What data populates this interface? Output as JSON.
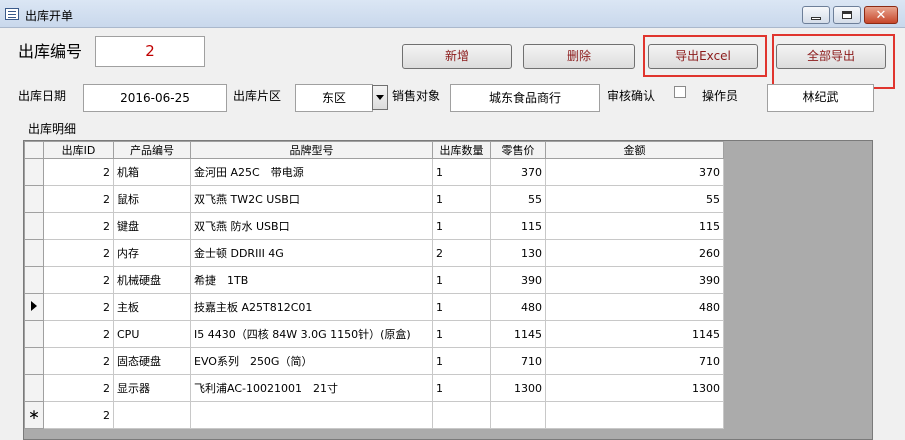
{
  "window": {
    "title": "出库开单"
  },
  "form": {
    "order_no_label": "出库编号",
    "order_no_value": "2",
    "date_label": "出库日期",
    "date_value": "2016-06-25",
    "area_label": "出库片区",
    "area_value": "东区",
    "customer_label": "销售对象",
    "customer_value": "城东食品商行",
    "approve_label": "审核确认",
    "operator_label": "操作员",
    "operator_value": "林纪武",
    "detail_label": "出库明细"
  },
  "buttons": {
    "add": "新增",
    "delete": "删除",
    "export_excel": "导出Excel",
    "export_all": "全部导出"
  },
  "table": {
    "columns": [
      "出库ID",
      "产品编号",
      "品牌型号",
      "出库数量",
      "零售价",
      "金额"
    ],
    "rows": [
      {
        "id": "2",
        "product": "机箱",
        "model": "金河田 A25C　带电源",
        "qty": "1",
        "price": "370",
        "amount": "370"
      },
      {
        "id": "2",
        "product": "鼠标",
        "model": "双飞燕 TW2C USB口",
        "qty": "1",
        "price": "55",
        "amount": "55"
      },
      {
        "id": "2",
        "product": "键盘",
        "model": "双飞燕 防水 USB口",
        "qty": "1",
        "price": "115",
        "amount": "115"
      },
      {
        "id": "2",
        "product": "内存",
        "model": "金士顿 DDRIII 4G",
        "qty": "2",
        "price": "130",
        "amount": "260"
      },
      {
        "id": "2",
        "product": "机械硬盘",
        "model": "希捷　1TB",
        "qty": "1",
        "price": "390",
        "amount": "390"
      },
      {
        "id": "2",
        "product": "主板",
        "model": "技嘉主板 A25T812C01",
        "qty": "1",
        "price": "480",
        "amount": "480"
      },
      {
        "id": "2",
        "product": "CPU",
        "model": "I5 4430（四核 84W 3.0G 1150针）(原盒)",
        "qty": "1",
        "price": "1145",
        "amount": "1145"
      },
      {
        "id": "2",
        "product": "固态硬盘",
        "model": "EVO系列　250G（简）",
        "qty": "1",
        "price": "710",
        "amount": "710"
      },
      {
        "id": "2",
        "product": "显示器",
        "model": "飞利浦AC-10021001　21寸",
        "qty": "1",
        "price": "1300",
        "amount": "1300"
      }
    ],
    "new_row_id": "2",
    "new_row_marker": "∗",
    "current_row_index": 5
  },
  "colors": {
    "highlight": "#e0352e",
    "button_text": "#8b1a1a",
    "order_no_text": "#c00000"
  }
}
